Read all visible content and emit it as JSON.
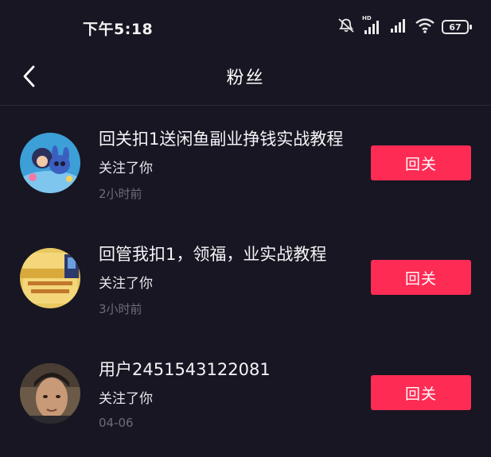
{
  "status_bar": {
    "time": "下午5:18",
    "network_label": "HD",
    "battery_level": "67"
  },
  "nav": {
    "title": "粉丝"
  },
  "followers": [
    {
      "name": "回关扣1送闲鱼副业挣钱实战教程",
      "action": "关注了你",
      "time": "2小时前",
      "button": "回关"
    },
    {
      "name": "回管我扣1，领福，业实战教程",
      "action": "关注了你",
      "time": "3小时前",
      "button": "回关"
    },
    {
      "name": "用户2451543122081",
      "action": "关注了你",
      "time": "04-06",
      "button": "回关"
    }
  ],
  "colors": {
    "background": "#171622",
    "button": "#fe2c55",
    "time_text": "#6d6c78"
  }
}
